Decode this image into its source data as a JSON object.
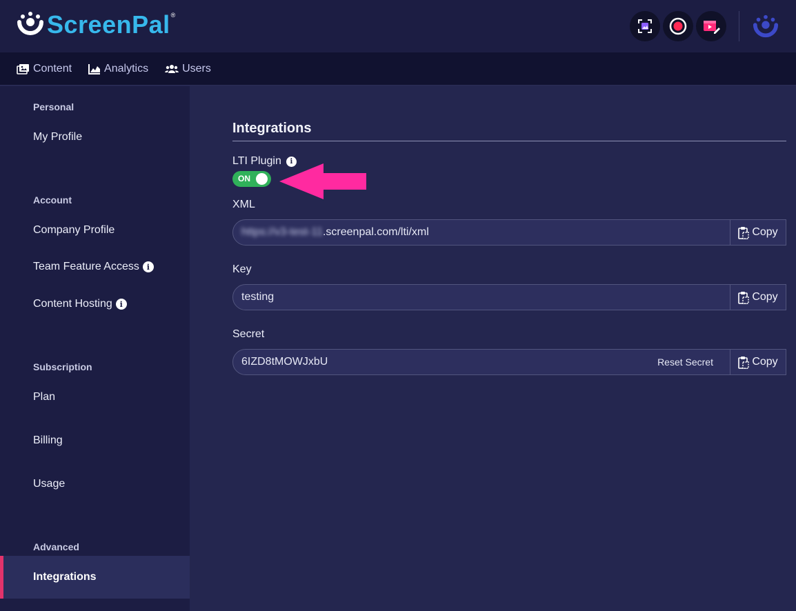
{
  "brand": {
    "name": "ScreenPal",
    "registered": "®",
    "color": "#37b8ec"
  },
  "header": {
    "actions": [
      {
        "name": "screenshot-icon",
        "color": "#8a5cff"
      },
      {
        "name": "record-icon",
        "color": "#ff2a55"
      },
      {
        "name": "video-edit-icon",
        "color": "#ff2a7a"
      }
    ]
  },
  "nav": {
    "items": [
      {
        "label": "Content",
        "icon": "images-icon"
      },
      {
        "label": "Analytics",
        "icon": "chart-icon"
      },
      {
        "label": "Users",
        "icon": "users-icon"
      }
    ]
  },
  "sidebar": {
    "groups": {
      "personal": "Personal",
      "account": "Account",
      "subscription": "Subscription",
      "advanced": "Advanced"
    },
    "items": {
      "my_profile": "My Profile",
      "company_profile": "Company Profile",
      "team_feature_access": "Team Feature Access",
      "content_hosting": "Content Hosting",
      "plan": "Plan",
      "billing": "Billing",
      "usage": "Usage",
      "integrations": "Integrations"
    },
    "active": "integrations",
    "accent": "#e2336b"
  },
  "main": {
    "title": "Integrations",
    "lti": {
      "label": "LTI Plugin",
      "toggle_text": "ON",
      "enabled": true,
      "toggle_color": "#30b15a"
    },
    "annotation_arrow_color": "#ff2aa0",
    "xml": {
      "label": "XML",
      "value_hidden": "https://v3-test-11",
      "value": ".screenpal.com/lti/xml"
    },
    "key": {
      "label": "Key",
      "value": "testing"
    },
    "secret": {
      "label": "Secret",
      "value": "6IZD8tMOWJxbU",
      "reset_label": "Reset Secret"
    },
    "copy_label": "Copy",
    "info_glyph": "i"
  }
}
